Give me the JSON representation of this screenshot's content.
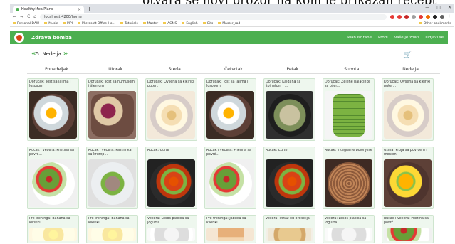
{
  "caption": "otvara se novi prozor na kom je prikazan recept obroka.",
  "browser": {
    "tab_title": "HealthyMealPlans",
    "new_tab": "+",
    "url": "localhost:4200/home",
    "nav_back": "←",
    "nav_forward": "→",
    "reload": "C",
    "home": "⌂",
    "bookmarks": [
      "Personal DAW",
      "Music",
      "MPI",
      "Microsoft Office Ho...",
      "Tutorials",
      "Master",
      "AGMS",
      "English",
      "Gifs",
      "Master_rad"
    ],
    "bookmarks_right": "Other bookmarks",
    "win_min": "—",
    "win_max": "□",
    "win_close": "✕"
  },
  "app": {
    "brand": "Zdrava bomba",
    "nav": [
      "Plan ishrane",
      "Profil",
      "Vaše je znati",
      "Odjavi se"
    ]
  },
  "week": {
    "prev": "«",
    "label": "5. Nedelja",
    "next": "»",
    "cart_icon": "cart-icon"
  },
  "days": [
    "Ponedeljak",
    "Utorak",
    "Sreda",
    "Četvrtak",
    "Petak",
    "Subota",
    "Nedelja"
  ],
  "meals": [
    [
      {
        "title": "Doručak: Tost sa jajima i lososom",
        "food": "toast"
      },
      {
        "title": "Doručak: Tost sa humusom i šlemom",
        "food": "berry"
      },
      {
        "title": "Doručak: Ovsena sa kikiriki puter...",
        "food": "oats"
      },
      {
        "title": "Doručak: Tost sa jajima i lososom",
        "food": "toast"
      },
      {
        "title": "Doručak: Kajgana sa špinatom i ...",
        "food": "pasta"
      },
      {
        "title": "Doručak: Zelene palačinke sa ošer...",
        "food": "green"
      },
      {
        "title": "Doručak: Ovsena sa kikiriki puter...",
        "food": "oats"
      }
    ],
    [
      {
        "title": "Ručak i večera: Piletina sa povrć...",
        "food": "salad"
      },
      {
        "title": "Ručak i večera: Pastrmka sa krump...",
        "food": "fish"
      },
      {
        "title": "Ručak: Ćufte",
        "food": "veg"
      },
      {
        "title": "Ručak i večera: Piletina sa povrć...",
        "food": "salad"
      },
      {
        "title": "Ručak: Ćufte",
        "food": "veg"
      },
      {
        "title": "Ručak: Integralne bolonjese",
        "food": "spag"
      },
      {
        "title": "Užina: Proja sa povrćem i mesom",
        "food": "yellow"
      }
    ],
    [
      {
        "title": "Pre treninga: Banana sa kikiriki...",
        "food": "fruit"
      },
      {
        "title": "Pre treninga: Banana sa kikiriki...",
        "food": "fruit"
      },
      {
        "title": "Večera: Losos plačica sa jogurta",
        "food": "white"
      },
      {
        "title": "Pre treninga: Jabuka sa kikiriki...",
        "food": "drink"
      },
      {
        "title": "Večera: Potaž od brokolija",
        "food": "wrap"
      },
      {
        "title": "Večera: Losos plačica sa jogurta",
        "food": "white"
      },
      {
        "title": "Ručak i večera: Piletina sa povrć...",
        "food": "salad"
      }
    ]
  ],
  "colors": {
    "nav_green": "#4caf50",
    "card_bg": "#eef7ee"
  }
}
